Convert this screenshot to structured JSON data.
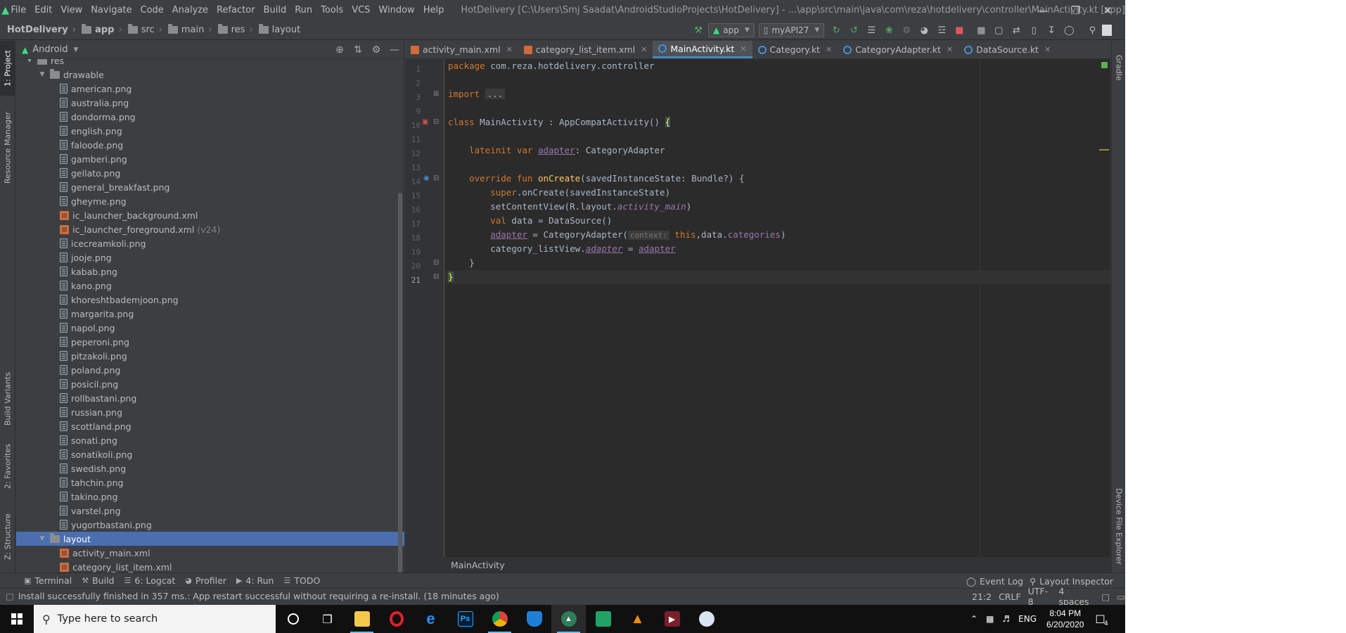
{
  "menubar": {
    "items": [
      "File",
      "Edit",
      "View",
      "Navigate",
      "Code",
      "Analyze",
      "Refactor",
      "Build",
      "Run",
      "Tools",
      "VCS",
      "Window",
      "Help"
    ],
    "window_title": "HotDelivery [C:\\Users\\Smj Saadat\\AndroidStudioProjects\\HotDelivery] - ...\\app\\src\\main\\java\\com\\reza\\hotdelivery\\controller\\MainActivity.kt [app]"
  },
  "navbar": {
    "breadcrumbs": [
      "HotDelivery",
      "app",
      "src",
      "main",
      "res",
      "layout"
    ],
    "run_config": "app",
    "device": "myAPI27"
  },
  "tool_windows_left": [
    "1: Project",
    "Resource Manager",
    "Build Variants",
    "2: Favorites",
    "Z: Structure"
  ],
  "tool_windows_right": [
    "Gradle",
    "Device File Explorer"
  ],
  "project": {
    "view_mode": "Android",
    "tree": [
      {
        "label": "res",
        "type": "folder",
        "depth": 1,
        "expanded": true
      },
      {
        "label": "drawable",
        "type": "folder",
        "depth": 2,
        "expanded": true
      },
      {
        "label": "american.png",
        "type": "file",
        "depth": 3
      },
      {
        "label": "australia.png",
        "type": "file",
        "depth": 3
      },
      {
        "label": "dondorma.png",
        "type": "file",
        "depth": 3
      },
      {
        "label": "english.png",
        "type": "file",
        "depth": 3
      },
      {
        "label": "faloode.png",
        "type": "file",
        "depth": 3
      },
      {
        "label": "gamberi.png",
        "type": "file",
        "depth": 3
      },
      {
        "label": "gellato.png",
        "type": "file",
        "depth": 3
      },
      {
        "label": "general_breakfast.png",
        "type": "file",
        "depth": 3
      },
      {
        "label": "gheyme.png",
        "type": "file",
        "depth": 3
      },
      {
        "label": "ic_launcher_background.xml",
        "type": "xml",
        "depth": 3
      },
      {
        "label": "ic_launcher_foreground.xml",
        "suffix": "(v24)",
        "type": "xml",
        "depth": 3
      },
      {
        "label": "icecreamkoli.png",
        "type": "file",
        "depth": 3
      },
      {
        "label": "jooje.png",
        "type": "file",
        "depth": 3
      },
      {
        "label": "kabab.png",
        "type": "file",
        "depth": 3
      },
      {
        "label": "kano.png",
        "type": "file",
        "depth": 3
      },
      {
        "label": "khoreshtbademjoon.png",
        "type": "file",
        "depth": 3
      },
      {
        "label": "margarita.png",
        "type": "file",
        "depth": 3
      },
      {
        "label": "napol.png",
        "type": "file",
        "depth": 3
      },
      {
        "label": "peperoni.png",
        "type": "file",
        "depth": 3
      },
      {
        "label": "pitzakoli.png",
        "type": "file",
        "depth": 3
      },
      {
        "label": "poland.png",
        "type": "file",
        "depth": 3
      },
      {
        "label": "posicil.png",
        "type": "file",
        "depth": 3
      },
      {
        "label": "rollbastani.png",
        "type": "file",
        "depth": 3
      },
      {
        "label": "russian.png",
        "type": "file",
        "depth": 3
      },
      {
        "label": "scottland.png",
        "type": "file",
        "depth": 3
      },
      {
        "label": "sonati.png",
        "type": "file",
        "depth": 3
      },
      {
        "label": "sonatikoli.png",
        "type": "file",
        "depth": 3
      },
      {
        "label": "swedish.png",
        "type": "file",
        "depth": 3
      },
      {
        "label": "tahchin.png",
        "type": "file",
        "depth": 3
      },
      {
        "label": "takino.png",
        "type": "file",
        "depth": 3
      },
      {
        "label": "varstel.png",
        "type": "file",
        "depth": 3
      },
      {
        "label": "yugortbastani.png",
        "type": "file",
        "depth": 3
      },
      {
        "label": "layout",
        "type": "folder",
        "depth": 2,
        "expanded": true,
        "selected": true
      },
      {
        "label": "activity_main.xml",
        "type": "xml",
        "depth": 3
      },
      {
        "label": "category_list_item.xml",
        "type": "xml",
        "depth": 3
      }
    ]
  },
  "editor": {
    "tabs": [
      {
        "label": "activity_main.xml",
        "kind": "xml",
        "active": false
      },
      {
        "label": "category_list_item.xml",
        "kind": "xml",
        "active": false
      },
      {
        "label": "MainActivity.kt",
        "kind": "kt",
        "active": true
      },
      {
        "label": "Category.kt",
        "kind": "kt",
        "active": false
      },
      {
        "label": "CategoryAdapter.kt",
        "kind": "kt",
        "active": false
      },
      {
        "label": "DataSource.kt",
        "kind": "kt",
        "active": false
      }
    ],
    "line_numbers": [
      "1",
      "2",
      "3",
      "9",
      "10",
      "11",
      "12",
      "13",
      "14",
      "15",
      "16",
      "17",
      "18",
      "19",
      "20",
      "21"
    ],
    "current_line": "21",
    "code": {
      "l1_kw": "package",
      "l1_txt": " com.reza.hotdelivery.controller",
      "l3_kw": "import",
      "l3_fold": "...",
      "l10_kw": "class",
      "l10_txt": " MainActivity : AppCompatActivity() ",
      "l10_brace": "{",
      "l12_kw": "lateinit var",
      "l12_prop": "adapter",
      "l12_txt": ": CategoryAdapter",
      "l14_kw": "override fun",
      "l14_fn": "onCreate",
      "l14_txt": "(savedInstanceState: Bundle?) {",
      "l15_kw": "super",
      "l15_txt": ".onCreate(savedInstanceState)",
      "l16_txt": "setContentView(R.layout.",
      "l16_prop": "activity_main",
      "l16_end": ")",
      "l17_kw": "val",
      "l17_txt": " data = DataSource()",
      "l18_prop": "adapter",
      "l18_txt": " = CategoryAdapter(",
      "l18_hint": "context:",
      "l18_kw": "this",
      "l18_txt2": ",data.",
      "l18_prop2": "categories",
      "l18_end": ")",
      "l19_txt": "category_listView.",
      "l19_prop": "adapter",
      "l19_eq": " = ",
      "l19_prop2": "adapter",
      "l20_txt": "}",
      "l21_brace": "}"
    },
    "breadcrumb": "MainActivity"
  },
  "bottom_tools": {
    "left": [
      "Terminal",
      "Build",
      "6: Logcat",
      "Profiler",
      "4: Run",
      "TODO"
    ],
    "right": [
      "Event Log",
      "Layout Inspector"
    ]
  },
  "status": {
    "message": "Install successfully finished in 357 ms.: App restart successful without requiring a re-install. (18 minutes ago)",
    "position": "21:2",
    "line_sep": "CRLF",
    "encoding": "UTF-8",
    "indent": "4 spaces"
  },
  "taskbar": {
    "search_placeholder": "Type here to search",
    "language": "ENG",
    "time": "8:04 PM",
    "date": "6/20/2020",
    "notifications": "4"
  },
  "colors": {
    "accent_blue": "#4b6eaf",
    "android_green": "#3ddc84",
    "keyword": "#cc7832",
    "function": "#ffc66d",
    "property": "#9876aa"
  }
}
